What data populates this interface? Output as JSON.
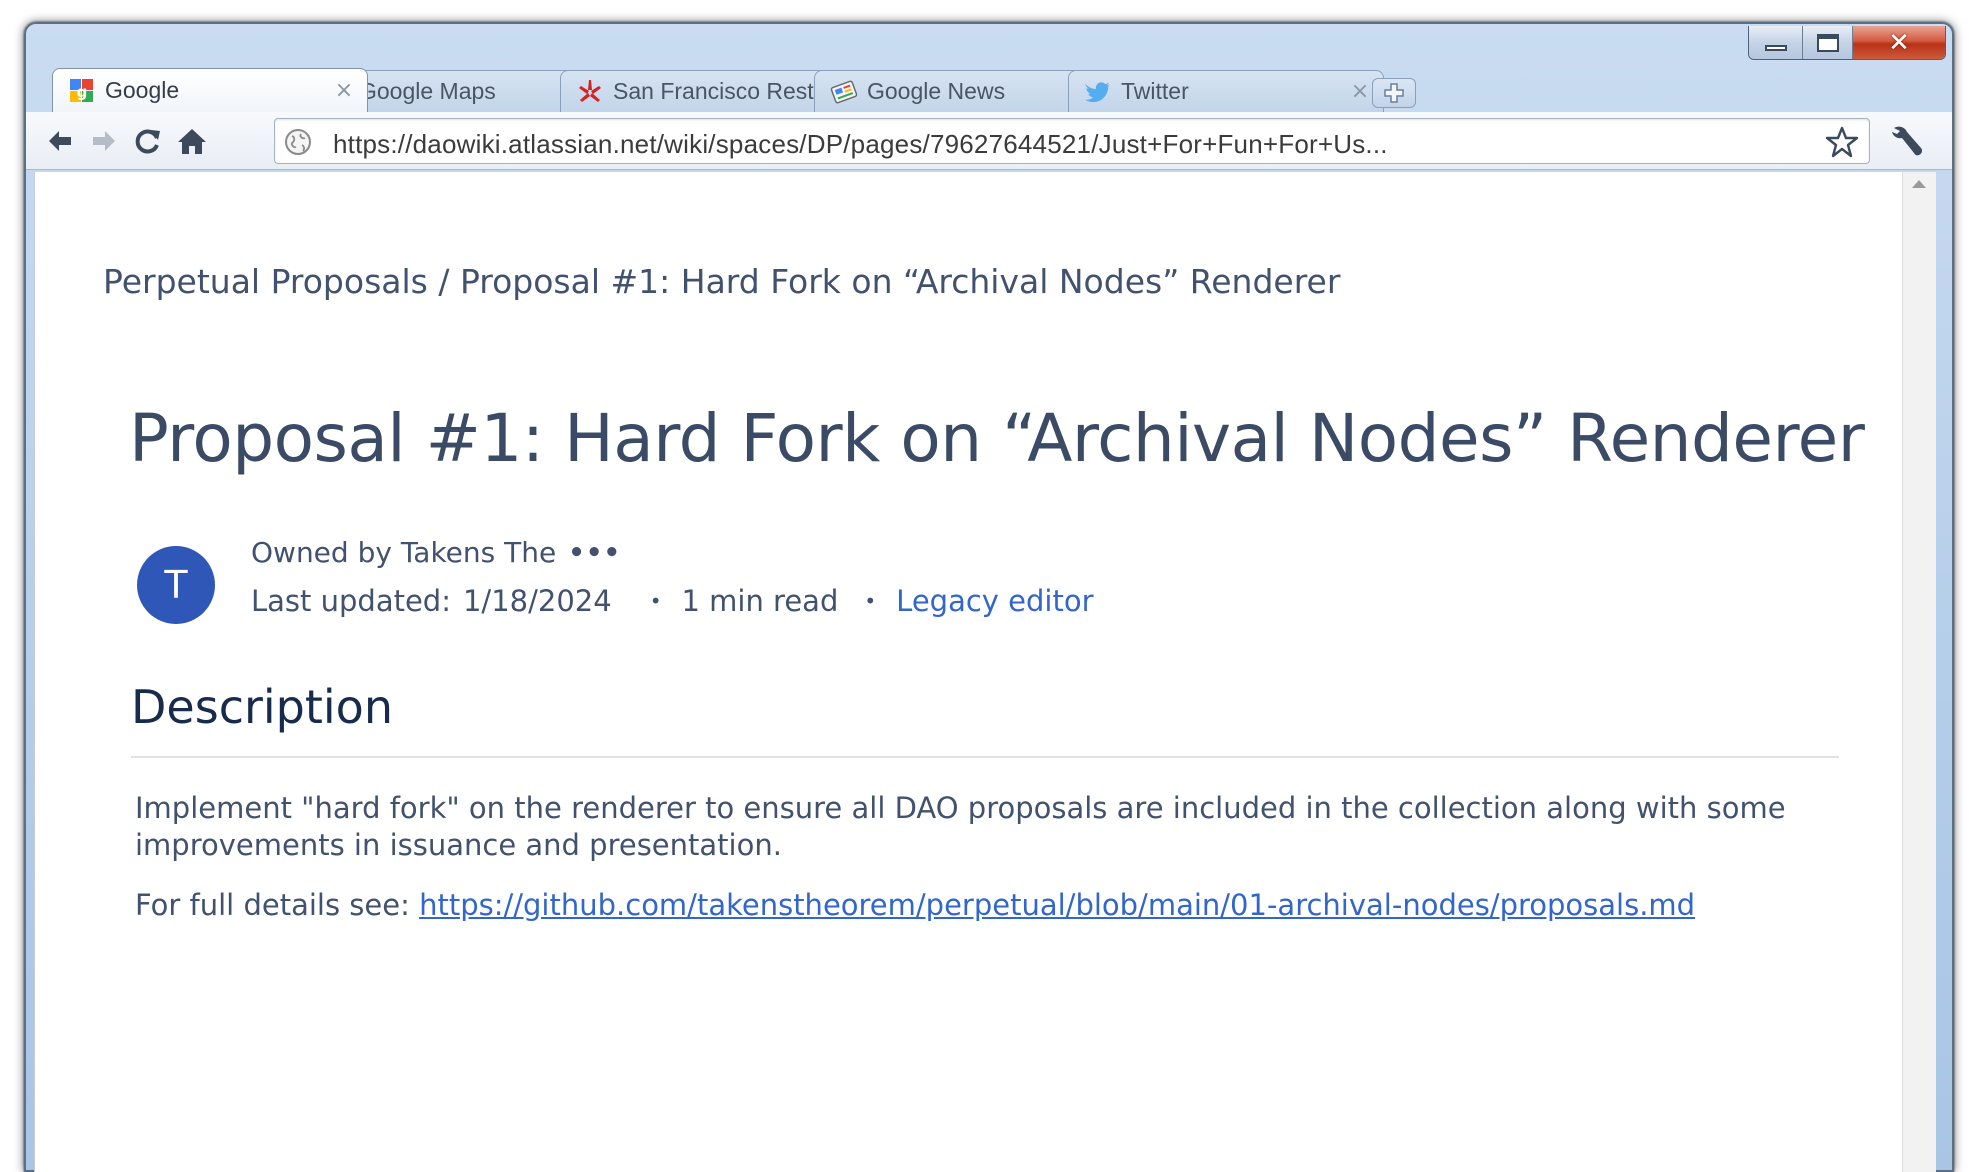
{
  "window": {
    "controls": {
      "minimize_icon": "minimize-icon",
      "maximize_icon": "maximize-icon",
      "close_icon": "close-icon",
      "close_glyph": "✕"
    }
  },
  "tabs": [
    {
      "title": "Google",
      "icon": "google-favicon",
      "active": true
    },
    {
      "title": "Google Maps",
      "icon": "google-maps-favicon",
      "active": false
    },
    {
      "title": "San Francisco Rest...",
      "icon": "yelp-favicon",
      "active": false
    },
    {
      "title": "Google News",
      "icon": "google-news-favicon",
      "active": false
    },
    {
      "title": "Twitter",
      "icon": "twitter-favicon",
      "active": false
    }
  ],
  "tab_close_glyph": "×",
  "toolbar": {
    "back_icon": "back-arrow-icon",
    "forward_icon": "forward-arrow-icon",
    "reload_icon": "reload-icon",
    "home_icon": "home-icon",
    "url": "https://daowiki.atlassian.net/wiki/spaces/DP/pages/79627644521/Just+For+Fun+For+Us...",
    "bookmark_icon": "star-icon",
    "wrench_icon": "wrench-icon"
  },
  "page": {
    "breadcrumb": "Perpetual Proposals / Proposal #1: Hard Fork on “Archival Nodes” Renderer",
    "title": "Proposal #1: Hard Fork on “Archival Nodes” Renderer",
    "avatar_initial": "T",
    "owner": "Owned by Takens The",
    "more": "•••",
    "last_updated_label": "Last updated:",
    "last_updated_value": "1/18/2024",
    "bullet": "•",
    "read_time": "1 min read",
    "legacy_editor": "Legacy editor",
    "section_heading": "Description",
    "description": "Implement \"hard fork\" on the renderer to ensure all DAO proposals are included in the collection along with some improvements in issuance and presentation.",
    "details_prefix": "For full details see: ",
    "details_link": "https://github.com/takenstheorem/perpetual/blob/main/01-archival-nodes/proposals.md"
  },
  "colors": {
    "text": "#42526e",
    "heading": "#172b4d",
    "link": "#3366cc",
    "avatar": "#2f57b8",
    "chrome_frame": "#b3cde9"
  }
}
